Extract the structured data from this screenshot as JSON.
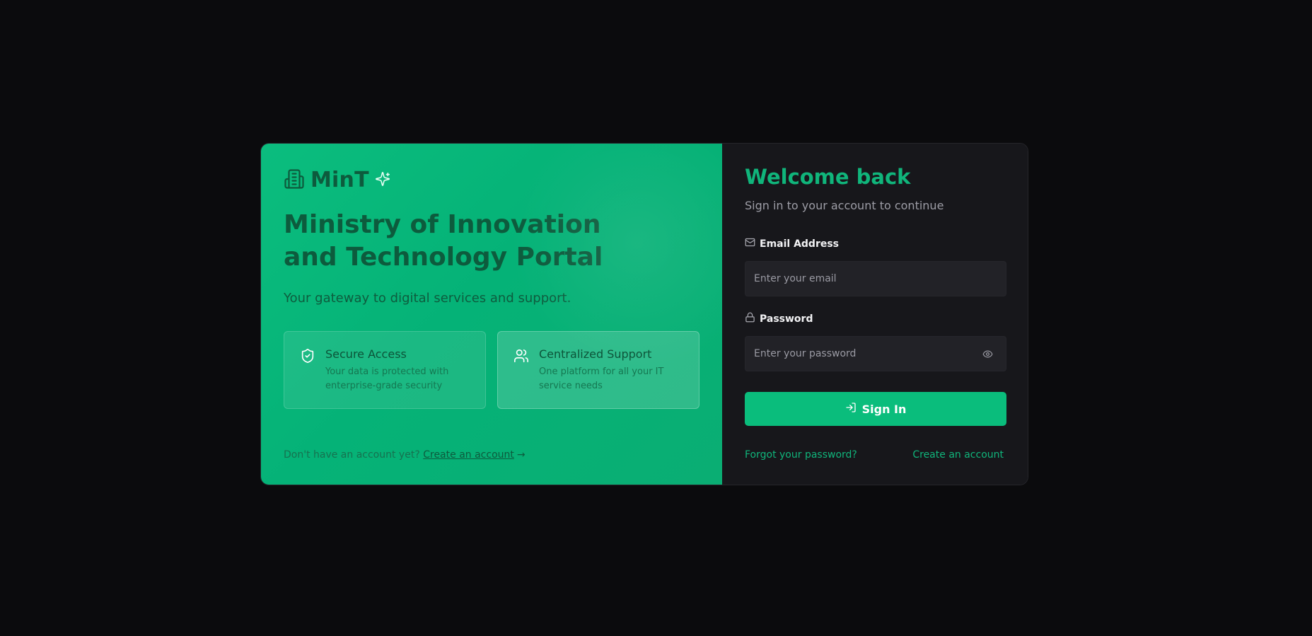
{
  "brand": {
    "name": "MinT",
    "icon": "building-icon",
    "badge_icon": "sparkles-icon"
  },
  "hero": {
    "headline": "Ministry of Innovation and Technology Portal",
    "tagline": "Your gateway to digital services and support."
  },
  "features": [
    {
      "icon": "shield-check-icon",
      "title": "Secure Access",
      "description": "Your data is protected with enterprise-grade security"
    },
    {
      "icon": "users-icon",
      "title": "Centralized Support",
      "description": "One platform for all your IT service needs"
    }
  ],
  "signup_prompt": {
    "text": "Don't have an account yet?",
    "link_label": "Create an account",
    "arrow": "→"
  },
  "login": {
    "title": "Welcome back",
    "subtitle": "Sign in to your account to continue",
    "email": {
      "label": "Email Address",
      "placeholder": "Enter your email",
      "value": "",
      "icon": "mail-icon"
    },
    "password": {
      "label": "Password",
      "placeholder": "Enter your password",
      "value": "",
      "icon": "lock-icon",
      "toggle_icon": "eye-icon"
    },
    "submit_label": "Sign In",
    "submit_icon": "log-in-icon",
    "forgot_label": "Forgot your password?",
    "create_label": "Create an account"
  },
  "colors": {
    "page_bg": "#0b0b0d",
    "brand_green": "#0abd7c",
    "panel_dark": "#17171b",
    "accent_text": "#10b57b",
    "headline_dark_green": "#0d5b3d"
  }
}
